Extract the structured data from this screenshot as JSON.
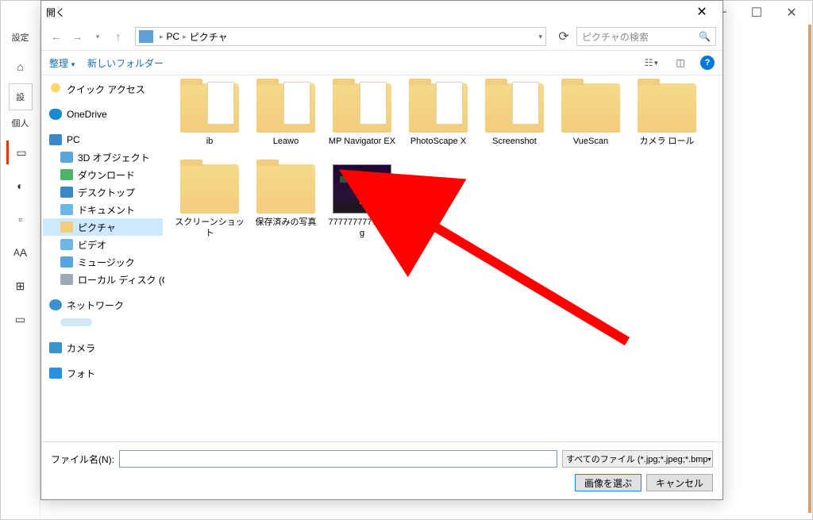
{
  "bg": {
    "settings_label": "設定",
    "set_btn": "設",
    "personal": "個人"
  },
  "dialog": {
    "title": "開く"
  },
  "breadcrumb": {
    "pc": "PC",
    "pictures": "ピクチャ"
  },
  "search": {
    "placeholder": "ピクチャの検索"
  },
  "toolbar": {
    "organize": "整理",
    "new_folder": "新しいフォルダー"
  },
  "tree": {
    "quick_access": "クイック アクセス",
    "onedrive": "OneDrive",
    "pc": "PC",
    "objects3d": "3D オブジェクト",
    "downloads": "ダウンロード",
    "desktop": "デスクトップ",
    "documents": "ドキュメント",
    "pictures": "ピクチャ",
    "videos": "ビデオ",
    "music": "ミュージック",
    "localdisk": "ローカル ディスク (C:)",
    "network": "ネットワーク",
    "camera": "カメラ",
    "photos": "フォト"
  },
  "items": [
    {
      "name": "ib",
      "type": "folder"
    },
    {
      "name": "Leawo",
      "type": "folder"
    },
    {
      "name": "MP Navigator EX",
      "type": "folder"
    },
    {
      "name": "PhotoScape X",
      "type": "folder"
    },
    {
      "name": "Screenshot",
      "type": "folder"
    },
    {
      "name": "VueScan",
      "type": "folder-plain"
    },
    {
      "name": "カメラ ロール",
      "type": "folder-plain"
    },
    {
      "name": "スクリーンショット",
      "type": "folder-plain"
    },
    {
      "name": "保存済みの写真",
      "type": "folder-plain"
    },
    {
      "name": "777777777777.jpg",
      "type": "image"
    }
  ],
  "bottom": {
    "filename_label": "ファイル名(N):",
    "filename_value": "",
    "filter": "すべてのファイル (*.jpg;*.jpeg;*.bmp",
    "open_btn": "画像を選ぶ",
    "cancel_btn": "キャンセル"
  }
}
